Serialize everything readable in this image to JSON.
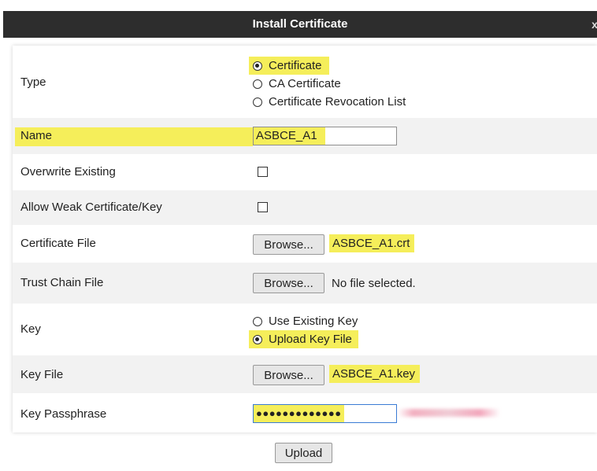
{
  "dialog": {
    "title": "Install Certificate",
    "close_glyph": "x"
  },
  "form": {
    "type": {
      "label": "Type",
      "options": [
        {
          "label": "Certificate",
          "selected": true
        },
        {
          "label": "CA Certificate",
          "selected": false
        },
        {
          "label": "Certificate Revocation List",
          "selected": false
        }
      ]
    },
    "name": {
      "label": "Name",
      "value": "ASBCE_A1"
    },
    "overwrite_existing": {
      "label": "Overwrite Existing",
      "checked": false
    },
    "allow_weak": {
      "label": "Allow Weak Certificate/Key",
      "checked": false
    },
    "certificate_file": {
      "label": "Certificate File",
      "browse_label": "Browse...",
      "file": "ASBCE_A1.crt"
    },
    "trust_chain_file": {
      "label": "Trust Chain File",
      "browse_label": "Browse...",
      "file": "No file selected."
    },
    "key": {
      "label": "Key",
      "options": [
        {
          "label": "Use Existing Key",
          "selected": false
        },
        {
          "label": "Upload Key File",
          "selected": true
        }
      ]
    },
    "key_file": {
      "label": "Key File",
      "browse_label": "Browse...",
      "file": "ASBCE_A1.key"
    },
    "key_passphrase": {
      "label": "Key Passphrase",
      "masked_value": "●●●●●●●●●●●●●"
    }
  },
  "actions": {
    "upload_label": "Upload"
  },
  "colors": {
    "highlight": "#f5ee5a",
    "titlebar": "#2d2d2d",
    "alt_row": "#f2f2f2",
    "focus_border": "#3a7bd5"
  }
}
